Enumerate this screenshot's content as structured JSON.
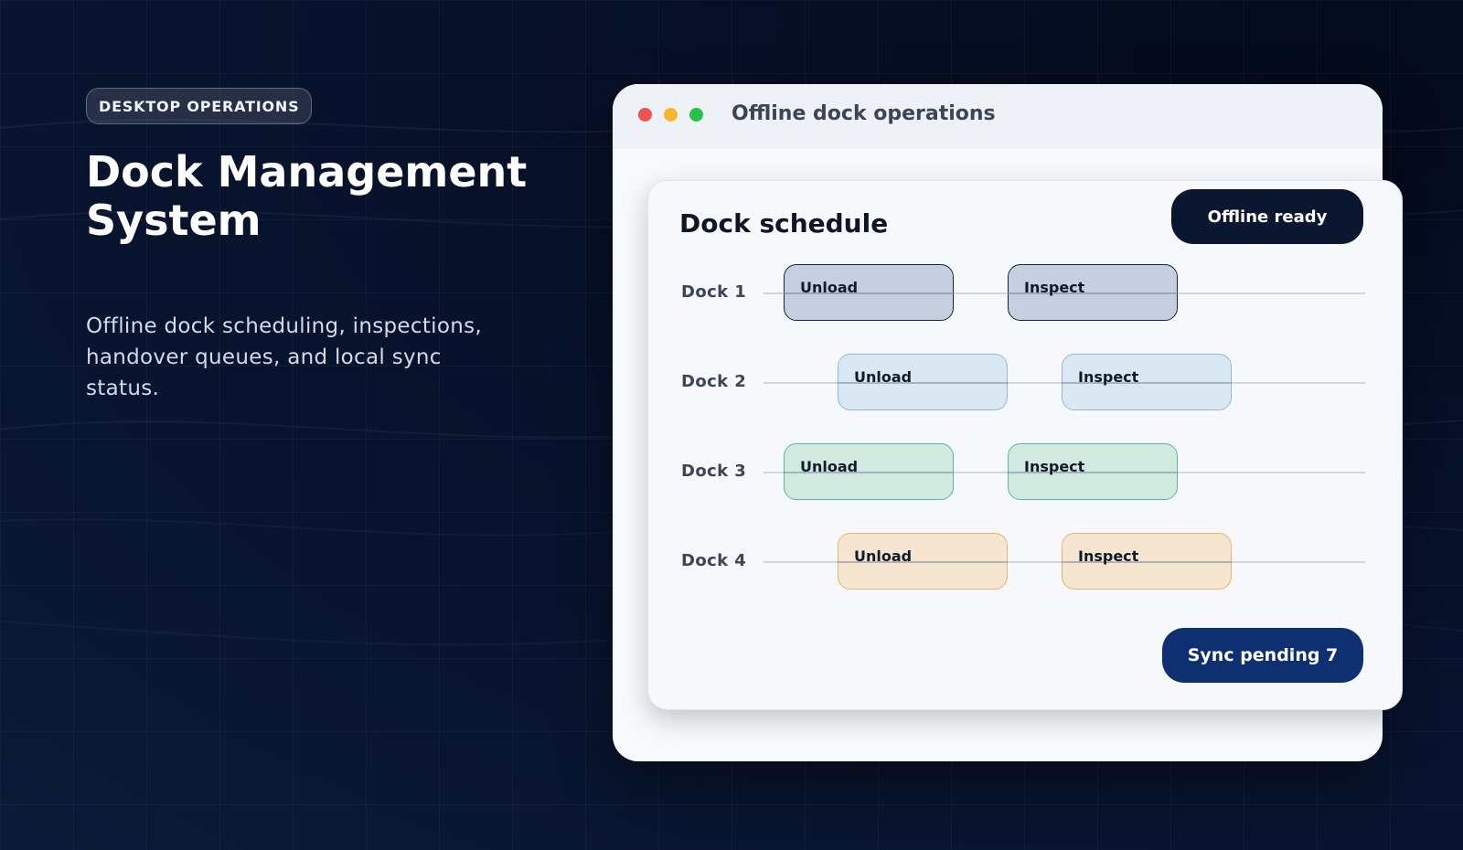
{
  "hero": {
    "badge": "DESKTOP OPERATIONS",
    "title": "Dock Management System",
    "subtitle": "Offline dock scheduling, inspections, handover queues, and local sync status."
  },
  "window": {
    "title": "Offline dock operations",
    "controls": [
      "close",
      "minimize",
      "maximize"
    ]
  },
  "panel": {
    "title": "Dock schedule",
    "status_button": "Offline ready",
    "sync_button": "Sync pending 7"
  },
  "docks": [
    {
      "label": "Dock 1",
      "tasks": [
        "Unload",
        "Inspect"
      ],
      "color": "#c5cfe0",
      "border": "#182438"
    },
    {
      "label": "Dock 2",
      "tasks": [
        "Unload",
        "Inspect"
      ],
      "color": "#dae8f4",
      "border": "#8fb8dc"
    },
    {
      "label": "Dock 3",
      "tasks": [
        "Unload",
        "Inspect"
      ],
      "color": "#d0eadf",
      "border": "#5bb88f"
    },
    {
      "label": "Dock 4",
      "tasks": [
        "Unload",
        "Inspect"
      ],
      "color": "#f6e6d1",
      "border": "#e7b667"
    }
  ]
}
